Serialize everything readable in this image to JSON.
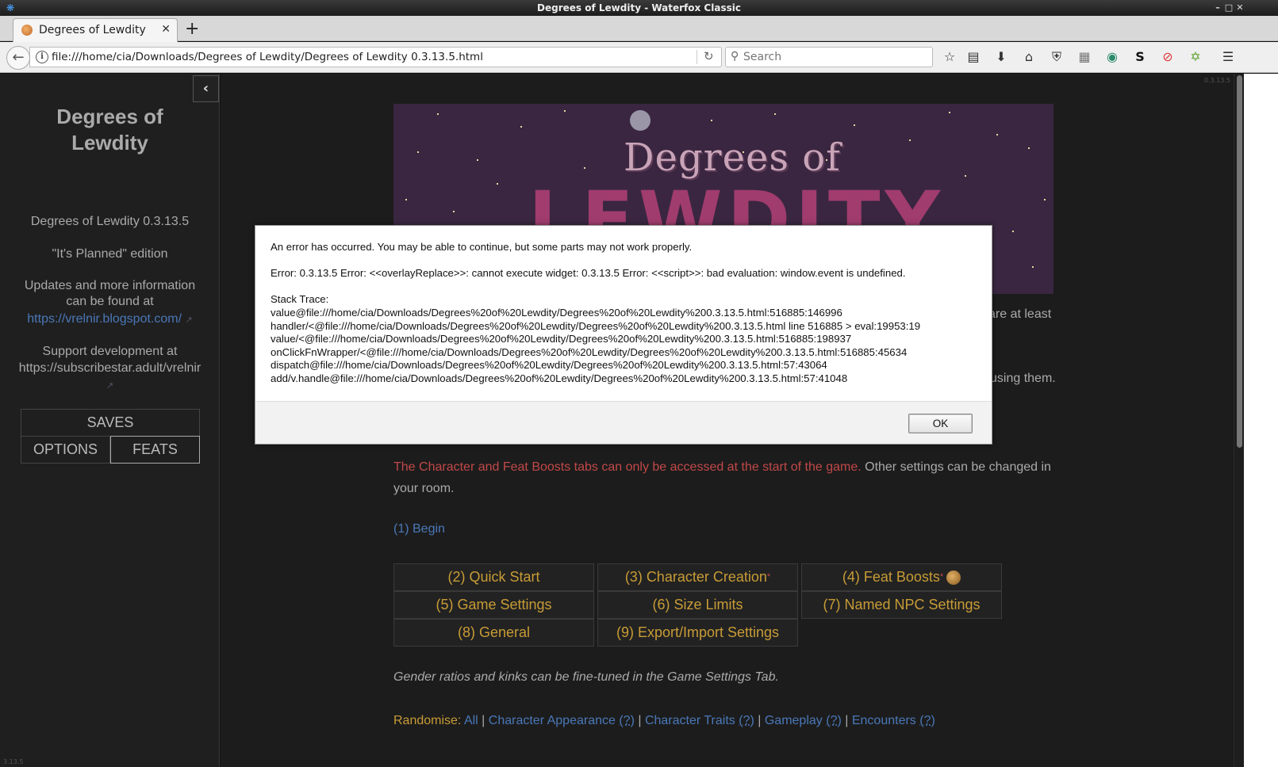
{
  "window": {
    "title": "Degrees of Lewdity - Waterfox Classic"
  },
  "browser": {
    "tab_title": "Degrees of Lewdity",
    "url": "file:///home/cia/Downloads/Degrees of Lewdity/Degrees of Lewdity 0.3.13.5.html",
    "search_placeholder": "Search"
  },
  "sidebar": {
    "title": "Degrees of Lewdity",
    "version": "Degrees of Lewdity 0.3.13.5",
    "edition": "\"It's Planned\" edition",
    "updates_text": "Updates and more information can be found at",
    "updates_link": "https://vrelnir.blogspot.com/",
    "support_text": "Support development at",
    "support_link": "https://subscribestar.adult/vrelnir",
    "buttons": {
      "saves": "SAVES",
      "options": "OPTIONS",
      "feats": "FEATS"
    },
    "footer_version": "3.13.5"
  },
  "main": {
    "corner_version": "0.3.13.5",
    "banner": {
      "line1": "Degrees of",
      "line2": "LEWDITY"
    },
    "cut_text_1": "are at least",
    "cut_text_2": "using them.",
    "warning_red": "The Character and Feat Boosts tabs can only be accessed at the start of the game.",
    "warning_rest": " Other settings can be changed in your room.",
    "begin_link": "(1) Begin",
    "grid": {
      "quick_start": "(2) Quick Start",
      "character_creation": "(3) Character Creation",
      "feat_boosts": "(4) Feat Boosts",
      "game_settings": "(5) Game Settings",
      "size_limits": "(6) Size Limits",
      "named_npc": "(7) Named NPC Settings",
      "general": "(8) General",
      "export_import": "(9) Export/Import Settings",
      "asterisk": "*"
    },
    "gender_note": "Gender ratios and kinks can be fine-tuned in the Game Settings Tab.",
    "randomise": {
      "label": "Randomise:",
      "all": "All",
      "appearance": "Character Appearance",
      "traits": "Character Traits",
      "gameplay": "Gameplay",
      "encounters": "Encounters",
      "q": "(?)",
      "sep": "|"
    }
  },
  "error_dialog": {
    "intro": "An error has occurred. You may be able to continue, but some parts may not work properly.",
    "message": "Error: 0.3.13.5 Error: <<overlayReplace>>: cannot execute widget: 0.3.13.5 Error: <<script>>: bad evaluation: window.event is undefined.",
    "stack_label": "Stack Trace:",
    "stack": [
      "value@file:///home/cia/Downloads/Degrees%20of%20Lewdity/Degrees%20of%20Lewdity%200.3.13.5.html:516885:146996",
      "handler/<@file:///home/cia/Downloads/Degrees%20of%20Lewdity/Degrees%20of%20Lewdity%200.3.13.5.html line 516885 > eval:19953:19",
      "value/<@file:///home/cia/Downloads/Degrees%20of%20Lewdity/Degrees%20of%20Lewdity%200.3.13.5.html:516885:198937",
      "onClickFnWrapper/<@file:///home/cia/Downloads/Degrees%20of%20Lewdity/Degrees%20of%20Lewdity%200.3.13.5.html:516885:45634",
      "dispatch@file:///home/cia/Downloads/Degrees%20of%20Lewdity/Degrees%20of%20Lewdity%200.3.13.5.html:57:43064",
      "add/v.handle@file:///home/cia/Downloads/Degrees%20of%20Lewdity/Degrees%20of%20Lewdity%200.3.13.5.html:57:41048"
    ],
    "ok": "OK"
  }
}
